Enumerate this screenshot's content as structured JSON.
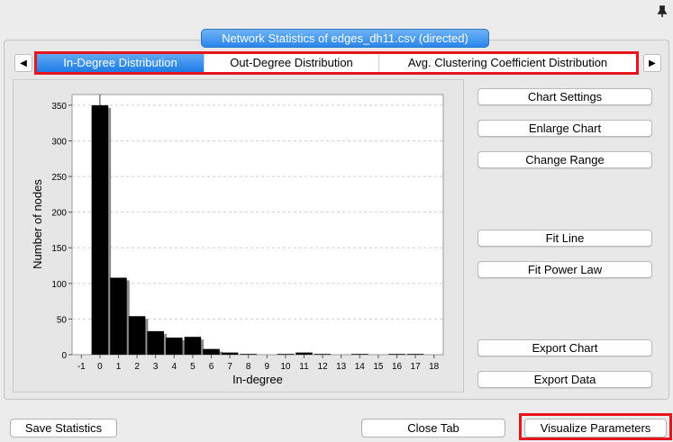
{
  "window": {
    "title": "Network Statistics of edges_dh11.csv (directed)"
  },
  "tabs": [
    {
      "label": "In-Degree Distribution",
      "active": true
    },
    {
      "label": "Out-Degree Distribution",
      "active": false
    },
    {
      "label": "Avg. Clustering Coefficient Distribution",
      "active": false
    }
  ],
  "icons": {
    "scroll_left": "left-arrow-icon",
    "scroll_right": "right-arrow-icon",
    "pin": "pin-icon"
  },
  "side_buttons": {
    "chart_settings": "Chart Settings",
    "enlarge_chart": "Enlarge Chart",
    "change_range": "Change Range",
    "fit_line": "Fit Line",
    "fit_power_law": "Fit Power Law",
    "export_chart": "Export Chart",
    "export_data": "Export Data"
  },
  "bottom_buttons": {
    "save_statistics": "Save Statistics",
    "close_tab": "Close Tab",
    "visualize_parameters": "Visualize Parameters"
  },
  "colors": {
    "accent": "#2a86ea",
    "highlight": "#e8141b",
    "bar": "#000000",
    "bar_shadow": "#8c8c8c"
  },
  "chart_data": {
    "type": "bar",
    "xlabel": "In-degree",
    "ylabel": "Number of nodes",
    "xlim": [
      -1.5,
      18.5
    ],
    "ylim": [
      0,
      365
    ],
    "x_ticks": [
      -1,
      0,
      1,
      2,
      3,
      4,
      5,
      6,
      7,
      8,
      9,
      10,
      11,
      12,
      13,
      14,
      15,
      16,
      17,
      18
    ],
    "y_ticks": [
      0,
      50,
      100,
      150,
      200,
      250,
      300,
      350
    ],
    "grid": true,
    "x": [
      0,
      1,
      2,
      3,
      4,
      5,
      6,
      7,
      8,
      9,
      10,
      11,
      12,
      13,
      14,
      15,
      16,
      17
    ],
    "values": [
      350,
      108,
      54,
      33,
      24,
      25,
      8,
      3,
      1,
      0,
      1,
      3,
      1,
      0,
      1,
      0,
      1,
      1
    ]
  }
}
